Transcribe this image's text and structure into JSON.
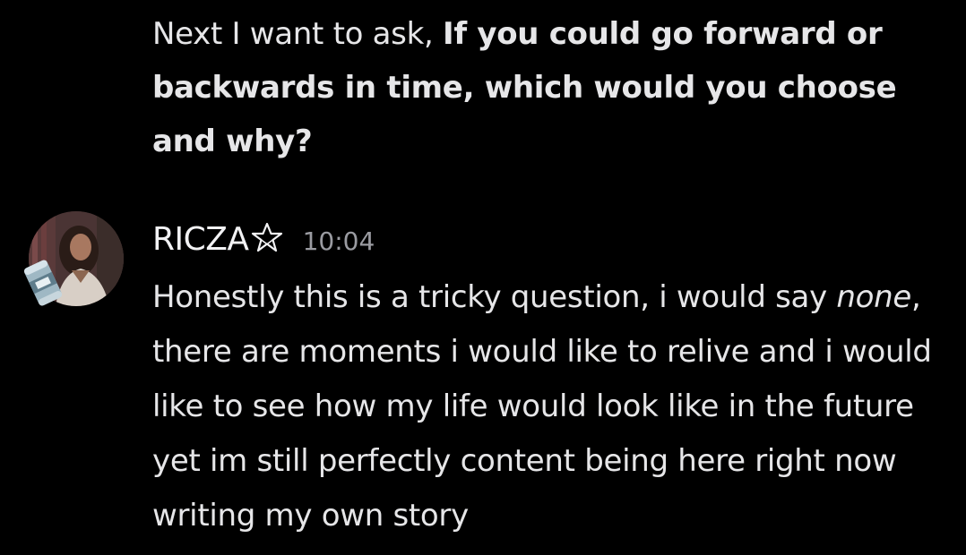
{
  "previous_message": {
    "plain": "Next I want to ask, ",
    "bold": "If you could go forward or backwards in time, which would you choose and why?"
  },
  "message": {
    "username": "RICZA",
    "role_icon": "pentagram-icon",
    "timestamp": "10:04",
    "text_before": "Honestly this is a tricky question, i would say ",
    "text_italic": "none",
    "text_after": ", there are moments i would like to relive and i would like to see how my life would look like in the future yet im still perfectly content being here right now writing my own story"
  },
  "colors": {
    "background": "#000000",
    "text": "#e6e6e8",
    "timestamp": "#9a9ba1"
  }
}
